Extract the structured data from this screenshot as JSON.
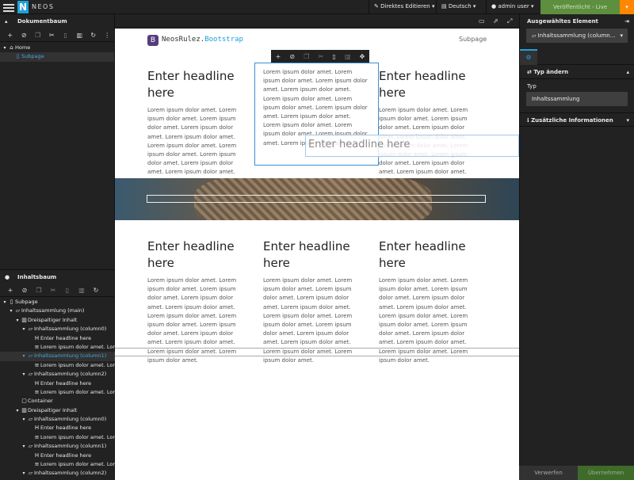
{
  "topbar": {
    "brand": "NEOS",
    "logo_letter": "N",
    "edit_mode": "Direktes Editieren",
    "language": "Deutsch",
    "user": "admin user",
    "publish": "Veröffentlicht - Live"
  },
  "document_tree": {
    "title": "Dokumentbaum",
    "nodes": [
      {
        "label": "Home",
        "depth": 0,
        "active": false
      },
      {
        "label": "Subpage",
        "depth": 1,
        "active": true
      }
    ]
  },
  "content_tree": {
    "title": "Inhaltsbaum",
    "nodes": [
      {
        "label": "Subpage",
        "depth": 0,
        "icon": "page",
        "active": false
      },
      {
        "label": "Inhaltssammlung (main)",
        "depth": 1,
        "icon": "folder",
        "active": false
      },
      {
        "label": "Dreispaltiger Inhalt",
        "depth": 2,
        "icon": "columns",
        "active": false
      },
      {
        "label": "Inhaltssammlung (column0)",
        "depth": 3,
        "icon": "folder",
        "active": false
      },
      {
        "label": "Enter headline here",
        "depth": 4,
        "icon": "headline",
        "active": false
      },
      {
        "label": "Lorem ipsum dolor amet. Lorem ipsum",
        "depth": 4,
        "icon": "text",
        "active": false
      },
      {
        "label": "Inhaltssammlung (column1)",
        "depth": 3,
        "icon": "folder",
        "active": true
      },
      {
        "label": "Lorem ipsum dolor amet. Lorem ipsum",
        "depth": 4,
        "icon": "text",
        "active": false
      },
      {
        "label": "Inhaltssammlung (column2)",
        "depth": 3,
        "icon": "folder",
        "active": false
      },
      {
        "label": "Enter headline here",
        "depth": 4,
        "icon": "headline",
        "active": false
      },
      {
        "label": "Lorem ipsum dolor amet. Lorem ipsum",
        "depth": 4,
        "icon": "text",
        "active": false
      },
      {
        "label": "Container",
        "depth": 2,
        "icon": "box",
        "active": false
      },
      {
        "label": "Dreispaltiger Inhalt",
        "depth": 2,
        "icon": "columns",
        "active": false
      },
      {
        "label": "Inhaltssammlung (column0)",
        "depth": 3,
        "icon": "folder",
        "active": false
      },
      {
        "label": "Enter headline here",
        "depth": 4,
        "icon": "headline",
        "active": false
      },
      {
        "label": "Lorem ipsum dolor amet. Lorem ipsum",
        "depth": 4,
        "icon": "text",
        "active": false
      },
      {
        "label": "Inhaltssammlung (column1)",
        "depth": 3,
        "icon": "folder",
        "active": false
      },
      {
        "label": "Enter headline here",
        "depth": 4,
        "icon": "headline",
        "active": false
      },
      {
        "label": "Lorem ipsum dolor amet. Lorem ipsum",
        "depth": 4,
        "icon": "text",
        "active": false
      },
      {
        "label": "Inhaltssammlung (column2)",
        "depth": 3,
        "icon": "folder",
        "active": false
      },
      {
        "label": "Enter headline here",
        "depth": 4,
        "icon": "headline",
        "active": false
      },
      {
        "label": "Lorem ipsum dolor amet. Lorem ipsum",
        "depth": 4,
        "icon": "text",
        "active": false
      }
    ]
  },
  "site": {
    "name_prefix": "NeosRulez.",
    "name_suffix": "Bootstrap",
    "logo_letter": "B",
    "nav_subpage": "Subpage",
    "headline": "Enter headline here",
    "lorem": "Lorem ipsum dolor amet. Lorem ipsum dolor amet. Lorem ipsum dolor amet. Lorem ipsum dolor amet. Lorem ipsum dolor amet. Lorem ipsum dolor amet. Lorem ipsum dolor amet. Lorem ipsum dolor amet. Lorem ipsum dolor amet. Lorem ipsum dolor amet. Lorem ipsum dolor amet. Lorem ipsum dolor amet.",
    "inline_placeholder": "Enter headline here"
  },
  "inspector": {
    "title": "Ausgewähltes Element",
    "selected": "Inhaltssammlung (column...",
    "change_type": "Typ ändern",
    "type_label": "Typ",
    "type_value": "Inhaltssammlung",
    "additional_info": "Zusätzliche Informationen",
    "discard": "Verwerfen",
    "apply": "Übernehmen"
  },
  "colors": {
    "accent": "#1ea0db",
    "publish_green": "#5d8f3e",
    "publish_orange": "#ff8700"
  }
}
